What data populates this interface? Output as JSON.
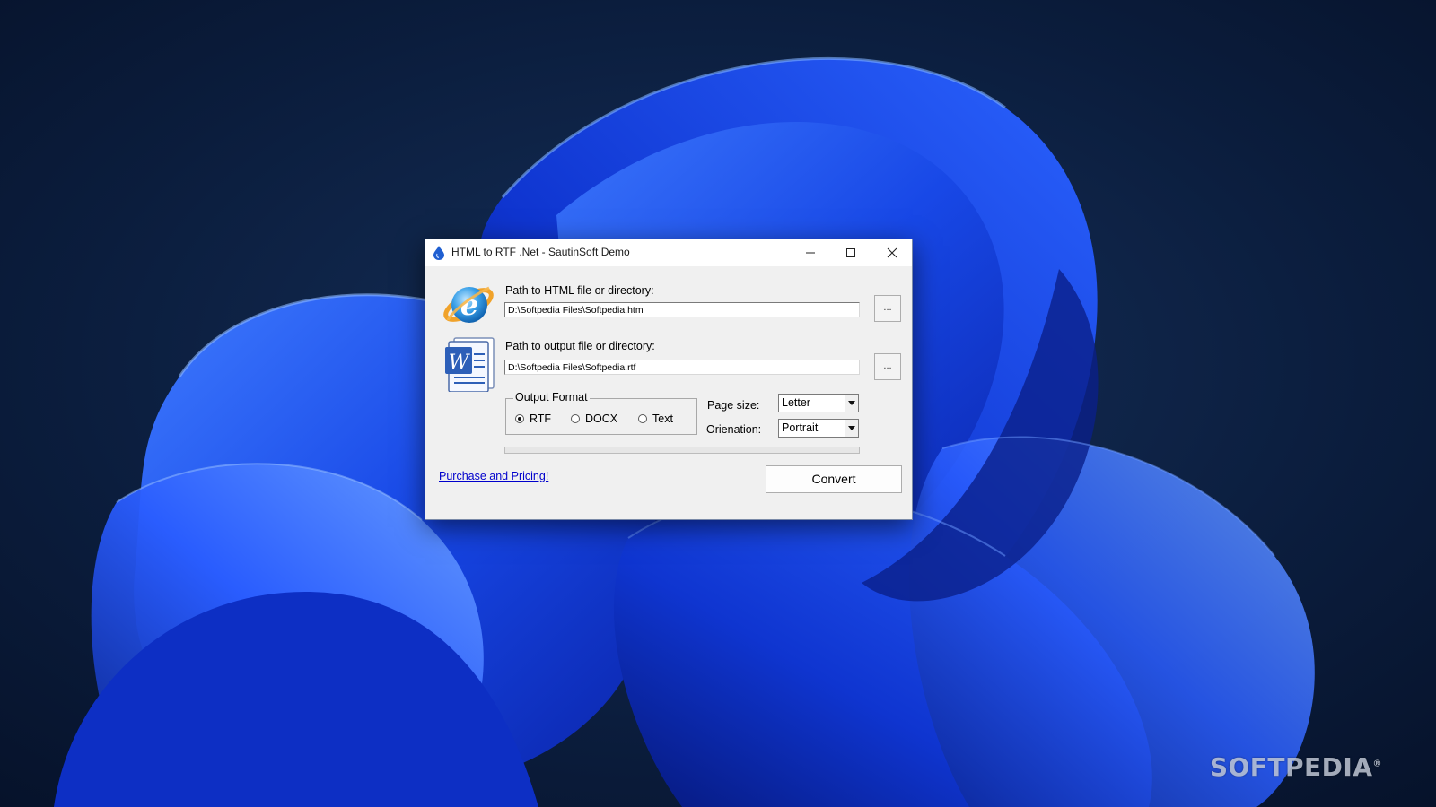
{
  "window": {
    "title": "HTML to RTF .Net - SautinSoft Demo",
    "icon": "water-drop-icon"
  },
  "titlebar_buttons": {
    "minimize": "minimize-icon",
    "maximize": "maximize-icon",
    "close": "close-icon"
  },
  "input": {
    "label": "Path to HTML file or directory:",
    "value": "D:\\Softpedia Files\\Softpedia.htm",
    "browse_label": "...",
    "icon": "internet-explorer-icon"
  },
  "output": {
    "label": "Path to output file or directory:",
    "value": "D:\\Softpedia Files\\Softpedia.rtf",
    "browse_label": "...",
    "icon": "word-document-icon"
  },
  "output_format": {
    "legend": "Output Format",
    "options": [
      {
        "label": "RTF",
        "checked": true
      },
      {
        "label": "DOCX",
        "checked": false
      },
      {
        "label": "Text",
        "checked": false
      }
    ]
  },
  "page_size": {
    "label": "Page size:",
    "selected": "Letter"
  },
  "orientation": {
    "label": "Orienation:",
    "selected": "Portrait"
  },
  "progress": {
    "fraction": 0
  },
  "purchase_link": "Purchase and Pricing!",
  "convert_label": "Convert",
  "watermark": {
    "text": "SOFTPEDIA",
    "mark": "®"
  },
  "colors": {
    "link": "#0000cc",
    "dialog_bg": "#f0f0f0",
    "wallpaper_accent": "#1e4bff"
  }
}
